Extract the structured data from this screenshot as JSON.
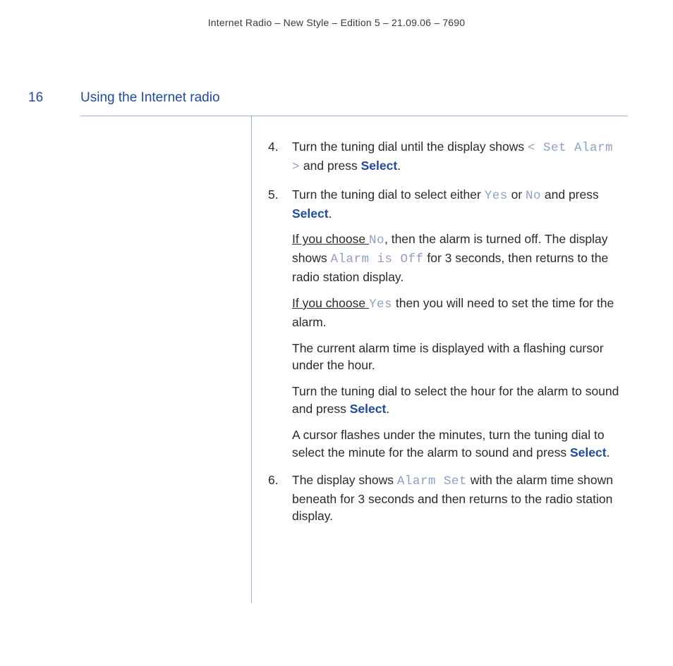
{
  "header": "Internet Radio – New Style – Edition 5 – 21.09.06 – 7690",
  "page_number": "16",
  "chapter_title": "Using the Internet radio",
  "ui": {
    "select": "Select",
    "set_alarm": "< Set Alarm >",
    "yes": "Yes",
    "no": "No",
    "no2": "No",
    "yes2": "Yes",
    "alarm_off": "Alarm is Off",
    "alarm_set": "Alarm Set"
  },
  "steps": {
    "s4_a": "Turn the tuning dial until the display shows ",
    "s4_b": " and press ",
    "s4_c": ".",
    "s5_a": "Turn the tuning dial to select either ",
    "s5_b": " or ",
    "s5_c": " and press ",
    "s5_d": ".",
    "p_no_lead": "If you choose ",
    "p_no_a": ", then the alarm is turned off. The display shows ",
    "p_no_b": " for 3 seconds, then returns to the radio station display.",
    "p_yes_lead": "If you choose ",
    "p_yes_a": " then you will need to set the time for the alarm.",
    "p_cursor": "The current alarm time is displayed with a flashing cursor under the hour.",
    "p_hour_a": "Turn the tuning dial to select the hour for the alarm to sound and press ",
    "p_hour_b": ".",
    "p_min_a": "A cursor flashes under the minutes, turn the tuning dial to select the minute for the alarm to sound and press ",
    "p_min_b": ".",
    "s6_a": "The display shows ",
    "s6_b": " with the alarm time shown beneath for 3 seconds and then returns to the radio station display."
  }
}
